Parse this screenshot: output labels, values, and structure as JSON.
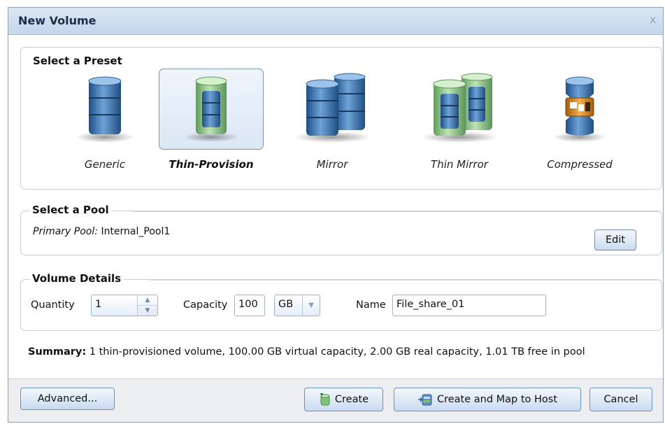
{
  "dialog": {
    "title": "New Volume",
    "close": "x"
  },
  "preset": {
    "title": "Select a Preset",
    "items": [
      {
        "label": "Generic",
        "icon": "generic-volume-icon",
        "selected": false
      },
      {
        "label": "Thin-Provision",
        "icon": "thin-provision-volume-icon",
        "selected": true
      },
      {
        "label": "Mirror",
        "icon": "mirror-volume-icon",
        "selected": false
      },
      {
        "label": "Thin Mirror",
        "icon": "thin-mirror-volume-icon",
        "selected": false
      },
      {
        "label": "Compressed",
        "icon": "compressed-volume-icon",
        "selected": false
      }
    ]
  },
  "pool": {
    "title": "Select a Pool",
    "primary_label": "Primary Pool:",
    "primary_value": "Internal_Pool1",
    "edit_label": "Edit"
  },
  "details": {
    "title": "Volume Details",
    "quantity_label": "Quantity",
    "quantity_value": "1",
    "capacity_label": "Capacity",
    "capacity_value": "100",
    "unit_value": "GB",
    "name_label": "Name",
    "name_value": "File_share_01"
  },
  "summary": {
    "label": "Summary:",
    "text": "1 thin-provisioned volume, 100.00 GB virtual capacity, 2.00 GB real capacity, 1.01 TB free in pool"
  },
  "footer": {
    "advanced_label": "Advanced...",
    "create_label": "Create",
    "create_map_label": "Create and Map to Host",
    "cancel_label": "Cancel"
  },
  "colors": {
    "title_bar": "#c4d5ea",
    "button_border": "#6f8fb9",
    "volume_blue": "#3f76b3",
    "volume_green": "#7fc27a",
    "compress_orange": "#e28a1e"
  }
}
